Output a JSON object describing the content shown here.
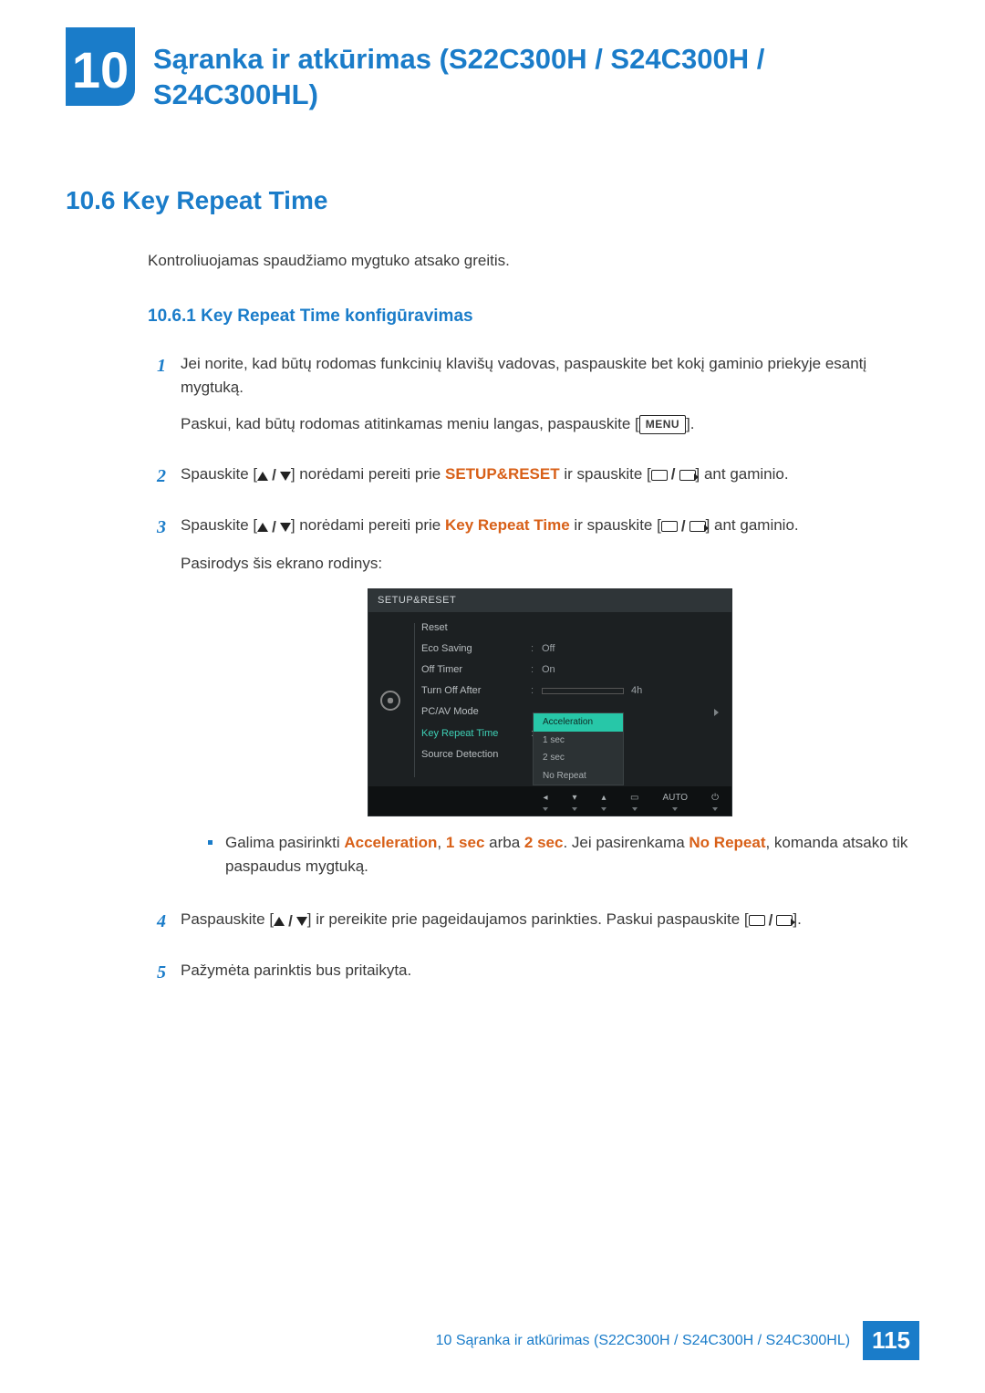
{
  "chapter": {
    "number": "10",
    "title": "Sąranka ir atkūrimas (S22C300H / S24C300H / S24C300HL)"
  },
  "section": {
    "number_title": "10.6  Key Repeat Time",
    "intro": "Kontroliuojamas spaudžiamo mygtuko atsako greitis."
  },
  "subsection": {
    "number_title": "10.6.1  Key Repeat Time konfigūravimas"
  },
  "menu_label": "MENU",
  "steps": {
    "s1": {
      "num": "1",
      "p1": "Jei norite, kad būtų rodomas funkcinių klavišų vadovas, paspauskite bet kokį gaminio priekyje esantį mygtuką.",
      "p2a": "Paskui, kad būtų rodomas atitinkamas meniu langas, paspauskite [",
      "p2b": "]."
    },
    "s2": {
      "num": "2",
      "a": "Spauskite [",
      "b": "] norėdami pereiti prie ",
      "setup": "SETUP&RESET",
      "c": " ir spauskite [",
      "d": "] ant gaminio."
    },
    "s3": {
      "num": "3",
      "a": "Spauskite [",
      "b": "] norėdami pereiti prie ",
      "krt": "Key Repeat Time",
      "c": " ir spauskite [",
      "d": "] ant gaminio.",
      "after": "Pasirodys šis ekrano rodinys:"
    },
    "bullet": {
      "a": "Galima pasirinkti ",
      "opt1": "Acceleration",
      "sep1": ", ",
      "opt2": "1 sec",
      "mid": " arba ",
      "opt3": "2 sec",
      "sep2": ". Jei pasirenkama ",
      "opt4": "No Repeat",
      "tail": ", komanda atsako tik paspaudus mygtuką."
    },
    "s4": {
      "num": "4",
      "a": "Paspauskite [",
      "b": "] ir pereikite prie pageidaujamos parinkties. Paskui paspauskite [",
      "c": "]."
    },
    "s5": {
      "num": "5",
      "text": "Pažymėta parinktis bus pritaikyta."
    }
  },
  "osd": {
    "title": "SETUP&RESET",
    "rows": {
      "reset": {
        "label": "Reset",
        "val": ""
      },
      "eco": {
        "label": "Eco Saving",
        "val": "Off"
      },
      "timer": {
        "label": "Off Timer",
        "val": "On"
      },
      "turnoff": {
        "label": "Turn Off After",
        "val": "4h",
        "bar_pct": 20
      },
      "pcav": {
        "label": "PC/AV Mode",
        "val": ""
      },
      "krt": {
        "label": "Key Repeat Time",
        "val": ""
      },
      "srcd": {
        "label": "Source Detection",
        "val": ""
      }
    },
    "popup": [
      "Acceleration",
      "1 sec",
      "2 sec",
      "No Repeat"
    ],
    "footer_auto": "AUTO"
  },
  "footer": {
    "text": "10 Sąranka ir atkūrimas (S22C300H / S24C300H / S24C300HL)",
    "page": "115"
  }
}
